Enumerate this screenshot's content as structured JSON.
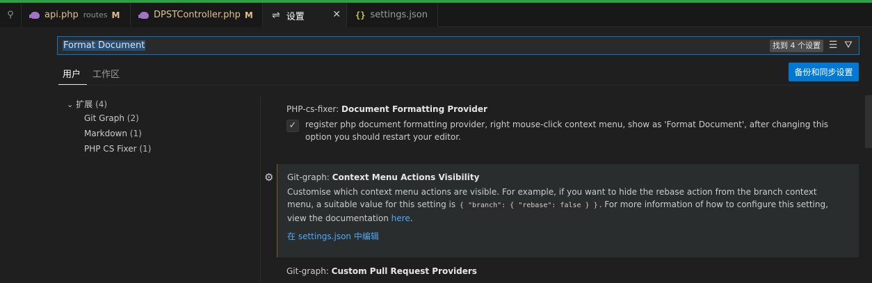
{
  "tabs": [
    {
      "label": "api.php",
      "sub": "routes",
      "badge": "M"
    },
    {
      "label": "DPSTController.php",
      "badge": "M"
    },
    {
      "label": "设置"
    },
    {
      "label": "settings.json"
    }
  ],
  "icons": {
    "pin": "pin-icon",
    "php": "php-elephant-icon",
    "settings": "settings-sliders-icon",
    "json": "json-braces-icon",
    "close": "close-icon",
    "clear": "clear-filter-icon",
    "filter": "filter-icon",
    "chevron": "chevron-down-icon",
    "gear": "gear-icon",
    "check": "check-icon"
  },
  "colors": {
    "accent": "#0078d4",
    "modified": "#e2c08d",
    "link": "#4daafc",
    "topline": "#2ea043"
  },
  "search": {
    "value": "Format Document",
    "found": "找到 4 个设置"
  },
  "scopes": {
    "user": "用户",
    "workspace": "工作区"
  },
  "backup_button": "备份和同步设置",
  "toc": [
    {
      "label": "扩展",
      "count": "(4)"
    },
    {
      "label": "Git Graph",
      "count": "(2)"
    },
    {
      "label": "Markdown",
      "count": "(1)"
    },
    {
      "label": "PHP CS Fixer",
      "count": "(1)"
    }
  ],
  "settings": [
    {
      "category": "PHP-cs-fixer: ",
      "title": "Document Formatting Provider",
      "desc": "register php document formatting provider, right mouse-click context menu, show as 'Format Document', after changing this option you should restart your editor."
    },
    {
      "category": "Git-graph: ",
      "title": "Context Menu Actions Visibility",
      "desc_a": "Customise which context menu actions are visible. For example, if you want to hide the rebase action from the branch context menu, a suitable value for this setting is ",
      "code": "{ \"branch\": { \"rebase\": false } }",
      "desc_b": ". For more information of how to configure this setting, view the documentation ",
      "link": "here",
      "desc_c": ".",
      "edit_link": "在 settings.json 中编辑"
    },
    {
      "category": "Git-graph: ",
      "title": "Custom Pull Request Providers"
    }
  ]
}
